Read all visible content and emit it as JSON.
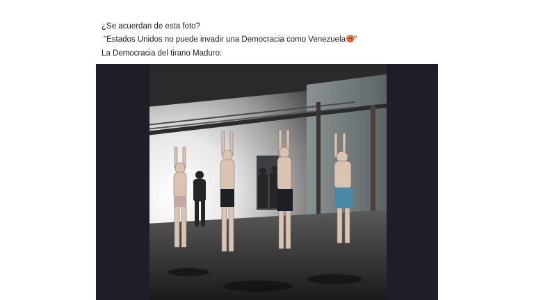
{
  "post": {
    "line1": "¿Se acuerdan de esta foto?",
    "line2": " \"Estados Unidos no puede invadir una Democracia como Venezuela",
    "line2_emoji": "angry-face-emoji",
    "line2_end": "\"",
    "line3": "La Democracia del tirano Maduro:"
  },
  "media": {
    "type": "video-frame",
    "letterbox_color": "#1f1e27"
  }
}
